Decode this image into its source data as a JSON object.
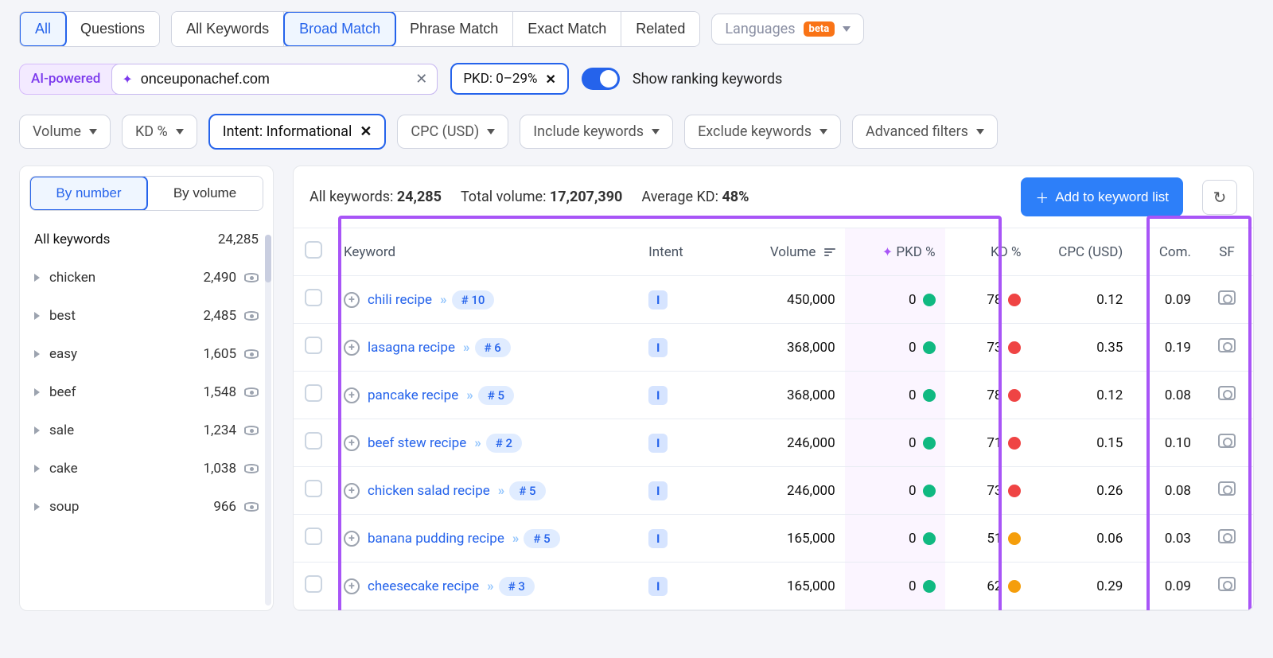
{
  "tabs_primary": {
    "all": "All",
    "questions": "Questions"
  },
  "tabs_secondary": {
    "all_keywords": "All Keywords",
    "broad_match": "Broad Match",
    "phrase_match": "Phrase Match",
    "exact_match": "Exact Match",
    "related": "Related"
  },
  "lang": {
    "label": "Languages",
    "beta": "beta"
  },
  "ai": {
    "label": "AI-powered",
    "value": "onceuponachef.com",
    "pkd": "PKD: 0–29%",
    "toggle_label": "Show ranking keywords"
  },
  "filters": {
    "volume": "Volume",
    "kd": "KD %",
    "intent": "Intent: Informational",
    "cpc": "CPC (USD)",
    "include": "Include keywords",
    "exclude": "Exclude keywords",
    "advanced": "Advanced filters"
  },
  "sidebar": {
    "by_number": "By number",
    "by_volume": "By volume",
    "header": {
      "label": "All keywords",
      "count": "24,285"
    },
    "items": [
      {
        "label": "chicken",
        "count": "2,490"
      },
      {
        "label": "best",
        "count": "2,485"
      },
      {
        "label": "easy",
        "count": "1,605"
      },
      {
        "label": "beef",
        "count": "1,548"
      },
      {
        "label": "sale",
        "count": "1,234"
      },
      {
        "label": "cake",
        "count": "1,038"
      },
      {
        "label": "soup",
        "count": "966"
      }
    ]
  },
  "stats": {
    "all_kw_label": "All keywords: ",
    "all_kw": "24,285",
    "total_vol_label": "Total volume: ",
    "total_vol": "17,207,390",
    "avg_kd_label": "Average KD: ",
    "avg_kd": "48%",
    "add_btn": "Add to keyword list"
  },
  "columns": {
    "keyword": "Keyword",
    "intent": "Intent",
    "volume": "Volume",
    "pkd": "PKD %",
    "kd": "KD %",
    "cpc": "CPC (USD)",
    "com": "Com.",
    "sf": "SF"
  },
  "rows": [
    {
      "kw": "chili recipe",
      "rank": "# 10",
      "intent": "I",
      "vol": "450,000",
      "pkd": "0",
      "pkdc": "green",
      "kd": "78",
      "kdc": "red",
      "cpc": "0.12",
      "com": "0.09"
    },
    {
      "kw": "lasagna recipe",
      "rank": "# 6",
      "intent": "I",
      "vol": "368,000",
      "pkd": "0",
      "pkdc": "green",
      "kd": "73",
      "kdc": "red",
      "cpc": "0.35",
      "com": "0.19"
    },
    {
      "kw": "pancake recipe",
      "rank": "# 5",
      "intent": "I",
      "vol": "368,000",
      "pkd": "0",
      "pkdc": "green",
      "kd": "78",
      "kdc": "red",
      "cpc": "0.12",
      "com": "0.08"
    },
    {
      "kw": "beef stew recipe",
      "rank": "# 2",
      "intent": "I",
      "vol": "246,000",
      "pkd": "0",
      "pkdc": "green",
      "kd": "71",
      "kdc": "red",
      "cpc": "0.15",
      "com": "0.10"
    },
    {
      "kw": "chicken salad recipe",
      "rank": "# 5",
      "intent": "I",
      "vol": "246,000",
      "pkd": "0",
      "pkdc": "green",
      "kd": "73",
      "kdc": "red",
      "cpc": "0.26",
      "com": "0.08"
    },
    {
      "kw": "banana pudding recipe",
      "rank": "# 5",
      "intent": "I",
      "vol": "165,000",
      "pkd": "0",
      "pkdc": "green",
      "kd": "51",
      "kdc": "orange",
      "cpc": "0.06",
      "com": "0.03"
    },
    {
      "kw": "cheesecake recipe",
      "rank": "# 3",
      "intent": "I",
      "vol": "165,000",
      "pkd": "0",
      "pkdc": "green",
      "kd": "62",
      "kdc": "orange",
      "cpc": "0.29",
      "com": "0.09"
    }
  ]
}
